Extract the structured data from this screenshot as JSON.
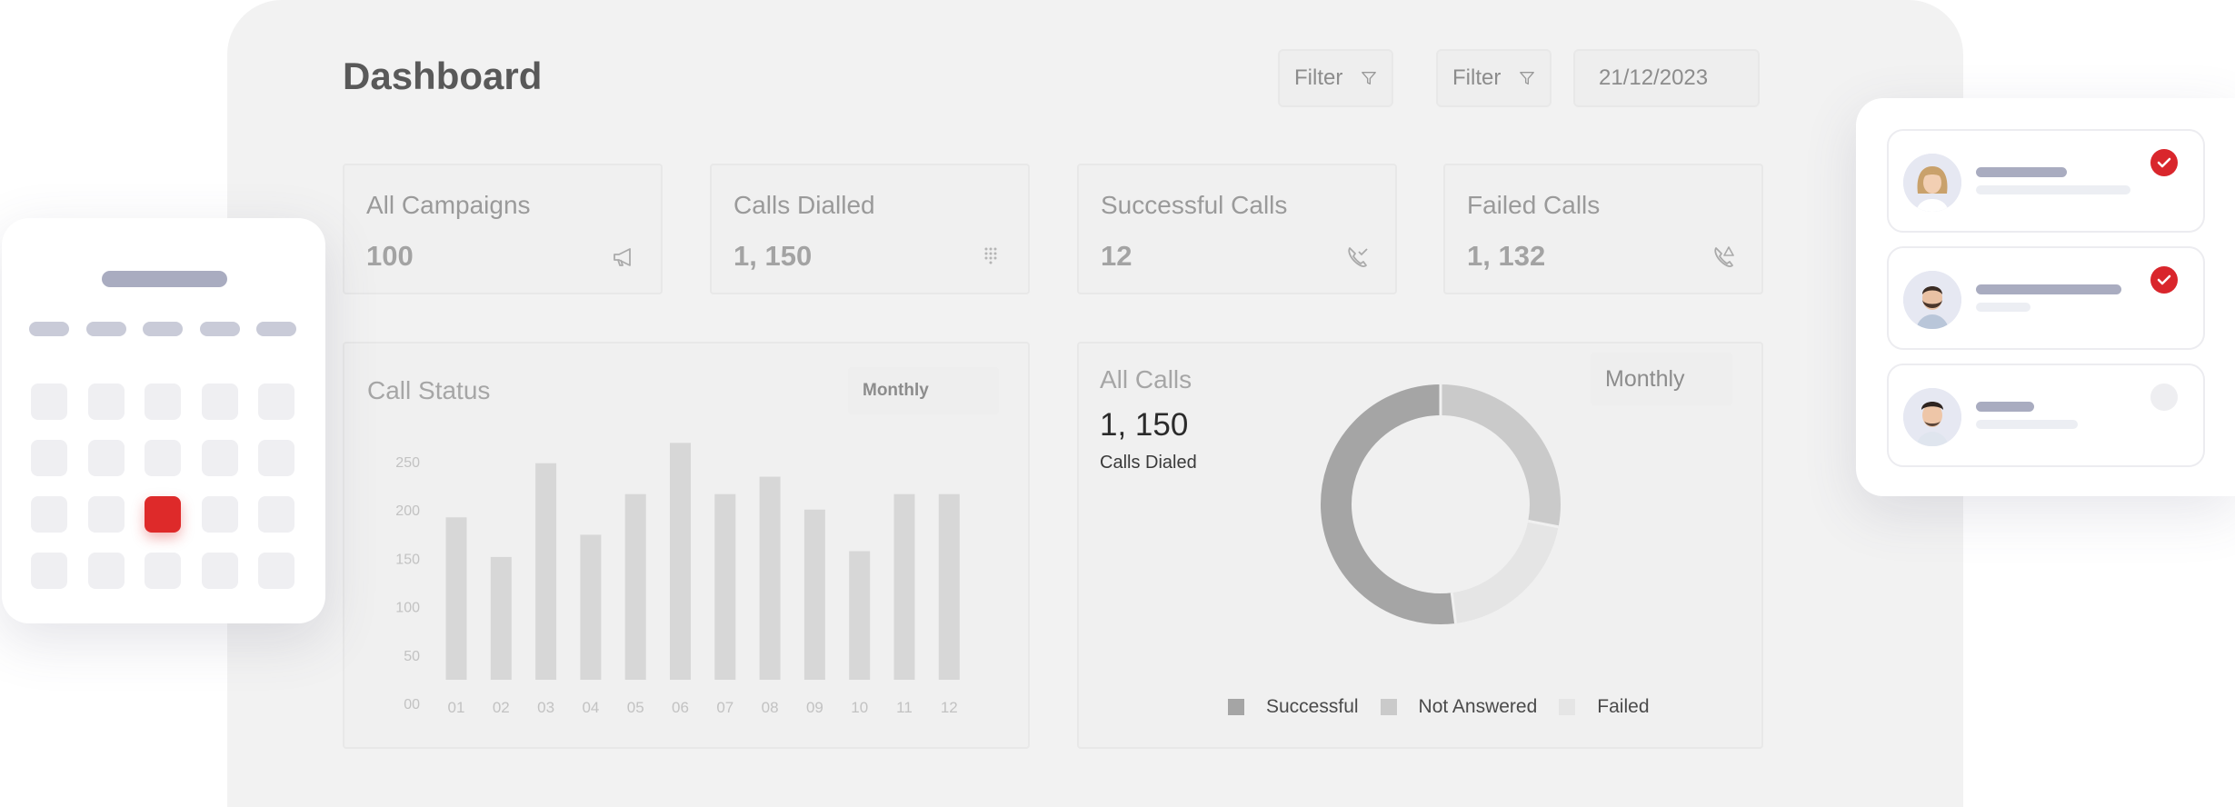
{
  "dashboard": {
    "title": "Dashboard",
    "filters": [
      {
        "label": "Filter",
        "icon": "funnel-icon"
      },
      {
        "label": "Filter",
        "icon": "funnel-icon"
      }
    ],
    "date": "21/12/2023"
  },
  "stats": [
    {
      "label": "All Campaigns",
      "value": "100",
      "icon": "megaphone-icon"
    },
    {
      "label": "Calls Dialled",
      "value": "1, 150",
      "icon": "dialpad-icon"
    },
    {
      "label": "Successful Calls",
      "value": "12",
      "icon": "phone-check-icon"
    },
    {
      "label": "Failed Calls",
      "value": "1, 132",
      "icon": "phone-alert-icon"
    }
  ],
  "call_status": {
    "title": "Call Status",
    "period": "Monthly"
  },
  "all_calls": {
    "title": "All Calls",
    "total": "1, 150",
    "total_label": "Calls Dialed",
    "period": "Monthly"
  },
  "chart_data": [
    {
      "type": "bar",
      "categories": [
        "01",
        "02",
        "03",
        "04",
        "05",
        "06",
        "07",
        "08",
        "09",
        "10",
        "11",
        "12"
      ],
      "values": [
        168,
        127,
        224,
        150,
        192,
        245,
        192,
        210,
        176,
        133,
        192,
        192
      ],
      "y_ticks": [
        "00",
        "50",
        "100",
        "150",
        "200",
        "250"
      ],
      "ylim": [
        0,
        250
      ],
      "title": "",
      "xlabel": "",
      "ylabel": "",
      "grid": false,
      "color": "#d7d7d7"
    },
    {
      "type": "pie",
      "donut": true,
      "labels": [
        "Successful",
        "Not Answered",
        "Failed"
      ],
      "values": [
        52,
        28,
        20
      ],
      "slice_order": [
        "Not Answered",
        "Failed",
        "Successful"
      ],
      "colors": {
        "Successful": "#a5a5a5",
        "Not Answered": "#cacaca",
        "Failed": "#e5e5e5"
      },
      "legend": "bottom"
    }
  ],
  "calendar": {
    "selected": {
      "row": 2,
      "col": 2
    },
    "accent": "#de2a2a"
  },
  "contacts": {
    "items": [
      {
        "avatar": "woman-avatar",
        "status": "checked"
      },
      {
        "avatar": "bearded-man-avatar",
        "status": "checked"
      },
      {
        "avatar": "man-avatar",
        "status": "unchecked"
      }
    ],
    "accent": "#d9262c"
  }
}
